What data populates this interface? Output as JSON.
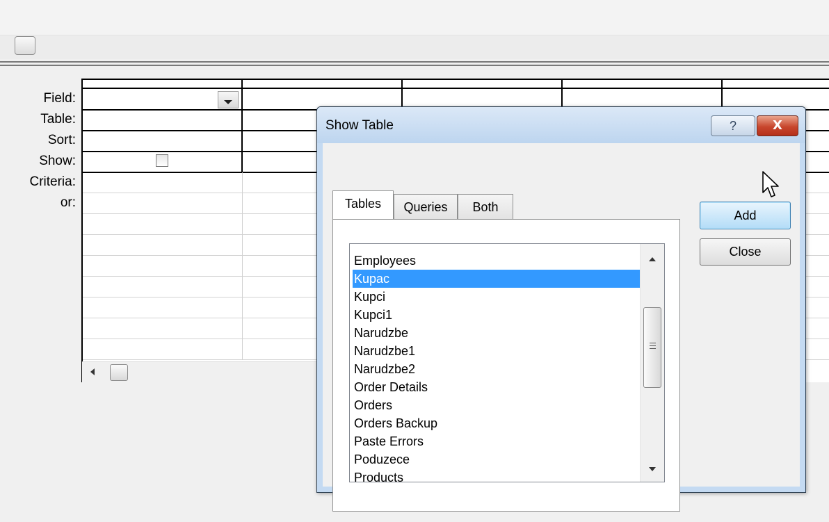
{
  "query_grid": {
    "row_labels": [
      "Field:",
      "Table:",
      "Sort:",
      "Show:",
      "Criteria:",
      "or:"
    ],
    "show_checked": false
  },
  "dialog": {
    "title": "Show Table",
    "help_label": "?",
    "close_label": "X",
    "tabs": [
      {
        "label": "Tables",
        "active": true
      },
      {
        "label": "Queries",
        "active": false
      },
      {
        "label": "Both",
        "active": false
      }
    ],
    "list_items": [
      "Employees",
      "Kupac",
      "Kupci",
      "Kupci1",
      "Narudzbe",
      "Narudzbe1",
      "Narudzbe2",
      "Order Details",
      "Orders",
      "Orders Backup",
      "Paste Errors",
      "Poduzece",
      "Products"
    ],
    "selected_item": "Kupac",
    "add_label": "Add",
    "close_button_label": "Close"
  },
  "colors": {
    "selection": "#3399ff",
    "title_bar": "#c4daf2",
    "close_button": "#c8462d"
  },
  "icons": {
    "cursor": "arrow-cursor-icon",
    "dropdown": "chevron-down-icon"
  }
}
